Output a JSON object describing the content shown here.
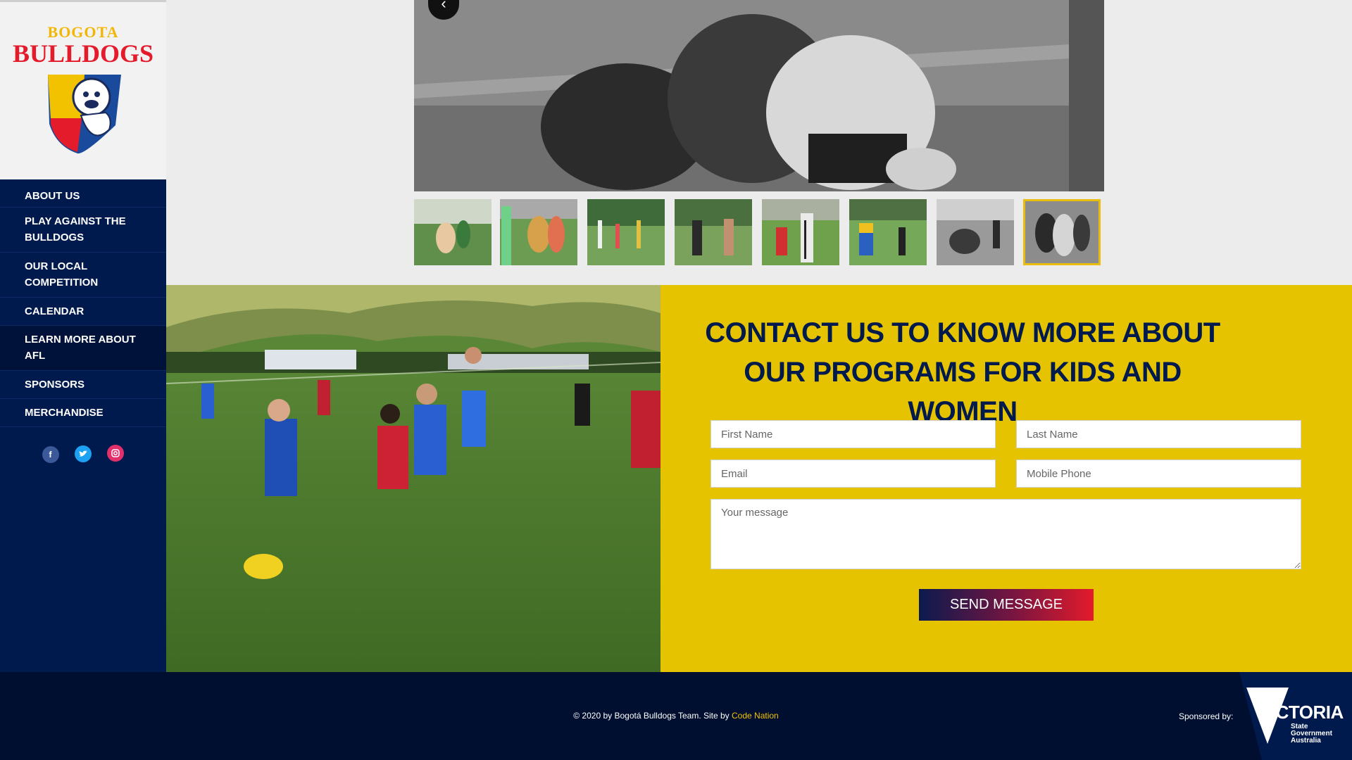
{
  "logo": {
    "line1": "BOGOTA",
    "line2": "BULLDOGS"
  },
  "nav": {
    "items": [
      {
        "label": "ABOUT US"
      },
      {
        "label": "PLAY AGAINST THE BULLDOGS"
      },
      {
        "label": "OUR LOCAL COMPETITION"
      },
      {
        "label": "CALENDAR"
      },
      {
        "label": "LEARN MORE ABOUT AFL"
      },
      {
        "label": "SPONSORS"
      },
      {
        "label": "MERCHANDISE"
      }
    ]
  },
  "social": {
    "facebook": "f",
    "twitter": "t",
    "instagram": "ig",
    "colors": {
      "facebook": "#3b5998",
      "twitter": "#1da1f2",
      "instagram": "#e1306c"
    }
  },
  "slider": {
    "prev_icon": "‹",
    "next_icon": "›",
    "thumbnails": 8,
    "selected_index": 7
  },
  "contact": {
    "title": "CONTACT US TO KNOW MORE ABOUT OUR PROGRAMS FOR KIDS AND WOMEN",
    "first_name_placeholder": "First Name",
    "last_name_placeholder": "Last Name",
    "email_placeholder": "Email",
    "mobile_placeholder": "Mobile Phone",
    "message_placeholder": "Your message",
    "send_label": "SEND MESSAGE"
  },
  "footer": {
    "copyright": "© 2020 by Bogotá Bulldogs Team. Site by ",
    "credit_link": "Code Nation",
    "sponsored_by": "Sponsored by:",
    "sponsor_name": "VICTORIA",
    "sponsor_sub1": "State",
    "sponsor_sub2": "Government",
    "sponsor_sub3": "Australia"
  },
  "colors": {
    "navy": "#001a4d",
    "yellow": "#e6c300",
    "red": "#e31b2b",
    "footer": "#000f30"
  }
}
